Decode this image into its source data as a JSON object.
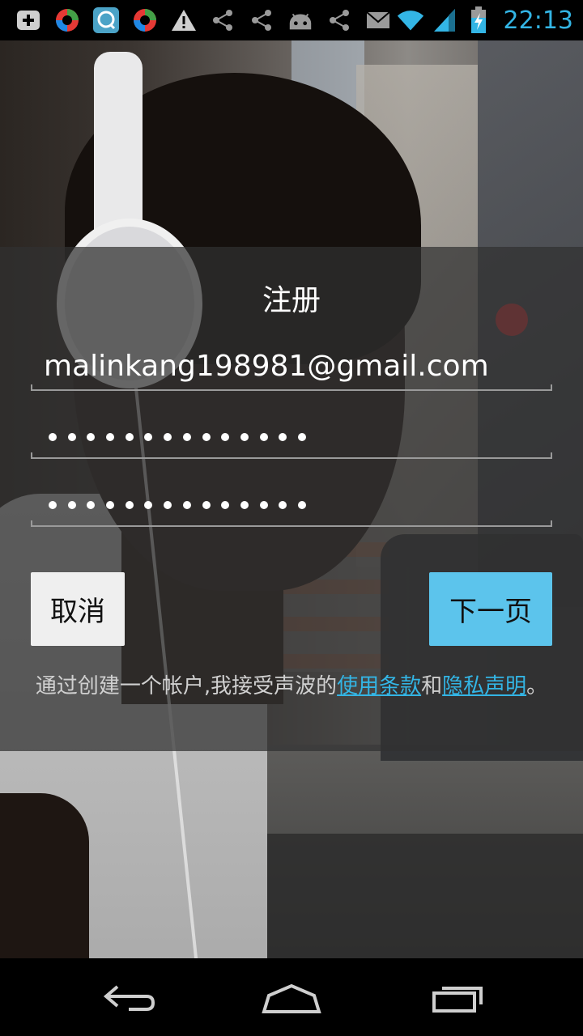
{
  "status_bar": {
    "time": "22:13",
    "notification_icons": [
      "add-box-icon",
      "colorful-app-icon",
      "message-app-icon",
      "colorful-app-icon",
      "warning-icon",
      "share-icon",
      "share-icon",
      "android-icon",
      "share-icon",
      "email-icon"
    ],
    "system_icons": [
      "wifi-icon",
      "signal-icon",
      "battery-charging-icon"
    ],
    "accent_color": "#33b5e5"
  },
  "signup": {
    "title": "注册",
    "email_value": "malinkang198981@gmail.com",
    "password_dot_count": 14,
    "confirm_password_dot_count": 14,
    "cancel_label": "取消",
    "next_label": "下一页",
    "terms_prefix": "通过创建一个帐户,我接受声波的",
    "terms_link": "使用条款",
    "terms_and": "和",
    "privacy_link": "隐私声明",
    "terms_suffix": "。",
    "next_button_color": "#5cc4ec"
  },
  "nav_bar": {
    "icons": [
      "back-icon",
      "home-icon",
      "recent-apps-icon"
    ]
  }
}
